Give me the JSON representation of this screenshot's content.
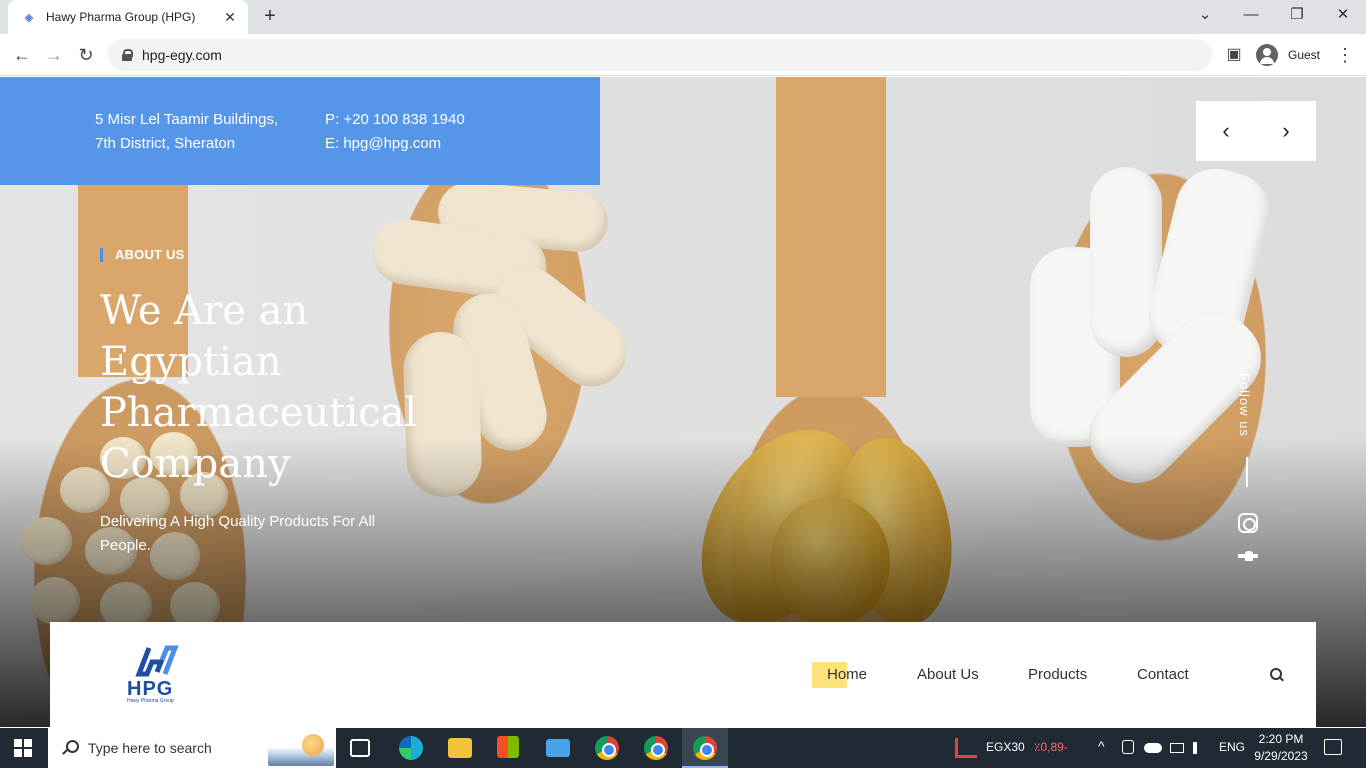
{
  "browser": {
    "tab_title": "Hawy Pharma Group (HPG)",
    "tab_close": "✕",
    "new_tab": "+",
    "url": "hpg-egy.com",
    "profile": "Guest",
    "min": "—",
    "max": "❐",
    "close": "✕",
    "restore_menu": "⌄",
    "back": "←",
    "forward": "→",
    "reload": "↻",
    "menu": "⋮",
    "sidepanel": "▣"
  },
  "contact": {
    "address_line1": "5 Misr Lel Taamir Buildings,",
    "address_line2": "7th District, Sheraton",
    "phone": "P: +20 100 838 1940",
    "email": "E: hpg@hpg.com"
  },
  "slider": {
    "prev": "‹",
    "next": "›"
  },
  "hero": {
    "tag": "ABOUT US",
    "headline": "We Are an Egyptian Pharmaceutical Company",
    "subtitle": "Delivering A High Quality Products For All People."
  },
  "social": {
    "follow": "Follow us"
  },
  "logo": {
    "text": "HPG",
    "tagline": "Hawy Pharma Group"
  },
  "nav": {
    "items": [
      "Home",
      "About Us",
      "Products",
      "Contact"
    ],
    "active": "Home"
  },
  "colors": {
    "accent": "#5596e9",
    "brand": "#1e4fa3",
    "highlight": "#fbe37a"
  },
  "taskbar": {
    "search_placeholder": "Type here to search",
    "stock_name": "EGX30",
    "stock_change": "٪0,89-",
    "lang": "ENG",
    "time": "2:20 PM",
    "date": "9/29/2023",
    "tray_up": "^"
  }
}
